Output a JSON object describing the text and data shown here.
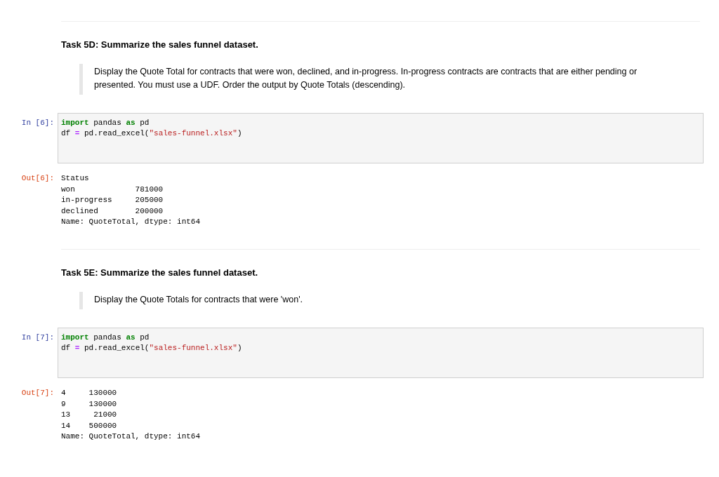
{
  "cells": [
    {
      "kind": "markdown",
      "title": "Task 5D: Summarize the sales funnel dataset.",
      "quote": "Display the Quote Total for contracts that were won, declined, and in-progress. In-progress contracts are contracts that are either pending or presented. You must use a UDF. Order the output by Quote Totals (descending)."
    },
    {
      "kind": "code",
      "prompt": "In [6]:",
      "lines": [
        [
          {
            "kind": "keyword",
            "text": "import"
          },
          {
            "kind": "plain",
            "text": " pandas "
          },
          {
            "kind": "keyword",
            "text": "as"
          },
          {
            "kind": "plain",
            "text": " pd"
          }
        ],
        [
          {
            "kind": "plain",
            "text": "df "
          },
          {
            "kind": "operator",
            "text": "="
          },
          {
            "kind": "plain",
            "text": " pd.read_excel("
          },
          {
            "kind": "string",
            "text": "\"sales-funnel.xlsx\""
          },
          {
            "kind": "plain",
            "text": ")"
          }
        ]
      ]
    },
    {
      "kind": "output",
      "prompt": "Out[6]:",
      "lines": [
        "Status",
        "won             781000",
        "in-progress     205000",
        "declined        200000",
        "Name: QuoteTotal, dtype: int64"
      ]
    },
    {
      "kind": "markdown",
      "title": "Task 5E: Summarize the sales funnel dataset.",
      "quote": "Display the Quote Totals for contracts that were 'won'."
    },
    {
      "kind": "code",
      "prompt": "In [7]:",
      "lines": [
        [
          {
            "kind": "keyword",
            "text": "import"
          },
          {
            "kind": "plain",
            "text": " pandas "
          },
          {
            "kind": "keyword",
            "text": "as"
          },
          {
            "kind": "plain",
            "text": " pd"
          }
        ],
        [
          {
            "kind": "plain",
            "text": "df "
          },
          {
            "kind": "operator",
            "text": "="
          },
          {
            "kind": "plain",
            "text": " pd.read_excel("
          },
          {
            "kind": "string",
            "text": "\"sales-funnel.xlsx\""
          },
          {
            "kind": "plain",
            "text": ")"
          }
        ]
      ]
    },
    {
      "kind": "output",
      "prompt": "Out[7]:",
      "lines": [
        "4     130000",
        "9     130000",
        "13     21000",
        "14    500000",
        "Name: QuoteTotal, dtype: int64"
      ]
    }
  ]
}
